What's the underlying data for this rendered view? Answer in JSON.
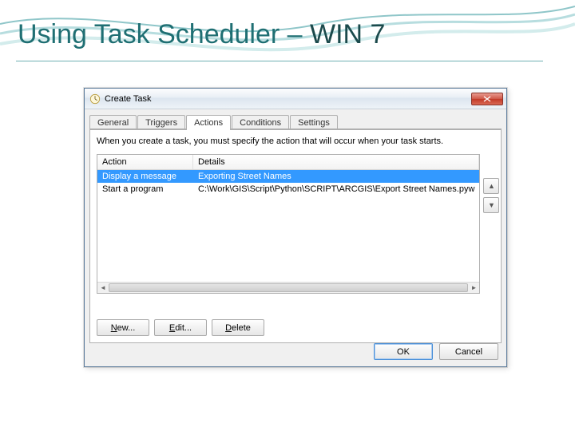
{
  "slide": {
    "title_prefix": "Using Task Scheduler – ",
    "title_suffix": "WIN 7"
  },
  "dialog": {
    "title": "Create Task",
    "tabs": {
      "general": "General",
      "triggers": "Triggers",
      "actions": "Actions",
      "conditions": "Conditions",
      "settings": "Settings"
    },
    "hint": "When you create a task, you must specify the action that will occur when your task starts.",
    "columns": {
      "action": "Action",
      "details": "Details"
    },
    "rows": [
      {
        "action": "Display a message",
        "details": "Exporting Street Names"
      },
      {
        "action": "Start a program",
        "details": "C:\\Work\\GIS\\Script\\Python\\SCRIPT\\ARCGIS\\Export Street Names.pyw"
      }
    ],
    "side": {
      "up": "▲",
      "down": "▼"
    },
    "panel_buttons": {
      "new_pre": "",
      "new_ul": "N",
      "new_post": "ew...",
      "edit_pre": "",
      "edit_ul": "E",
      "edit_post": "dit...",
      "delete_pre": "",
      "delete_ul": "D",
      "delete_post": "elete"
    },
    "footer": {
      "ok": "OK",
      "cancel": "Cancel"
    }
  }
}
